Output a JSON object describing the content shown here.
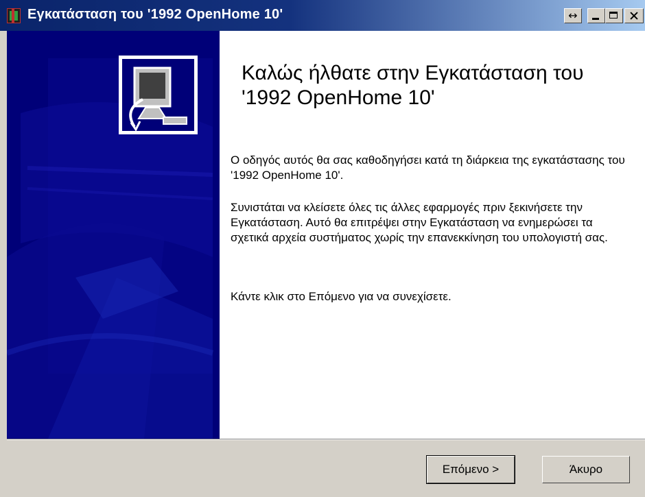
{
  "window": {
    "title": "Εγκατάσταση του '1992 OpenHome 10'",
    "resize_glyph": "↔",
    "icons": [
      "app-icon",
      "resize-icon",
      "minimize-icon",
      "maximize-icon",
      "close-icon",
      "installer-computer-icon"
    ]
  },
  "content": {
    "heading": "Καλώς ήλθατε στην Εγκατάσταση του '1992 OpenHome 10'",
    "paragraph1": "Ο οδηγός αυτός θα σας καθοδηγήσει κατά τη διάρκεια της εγκατάστασης του '1992 OpenHome 10'.",
    "paragraph2": "Συνιστάται να κλείσετε όλες τις άλλες εφαρμογές πριν ξεκινήσετε την Εγκατάσταση. Αυτό θα επιτρέψει στην Εγκατάσταση να ενημερώσει τα σχετικά αρχεία συστήματος χωρίς την επανεκκίνηση του υπολογιστή σας.",
    "paragraph3": "Κάντε κλικ στο Επόμενο για να συνεχίσετε."
  },
  "buttons": {
    "next": "Επόμενο >",
    "cancel": "Άκυρο"
  },
  "colors": {
    "sidebar": "#000078",
    "titlebar": "#0a246a",
    "face": "#d4d0c8"
  }
}
